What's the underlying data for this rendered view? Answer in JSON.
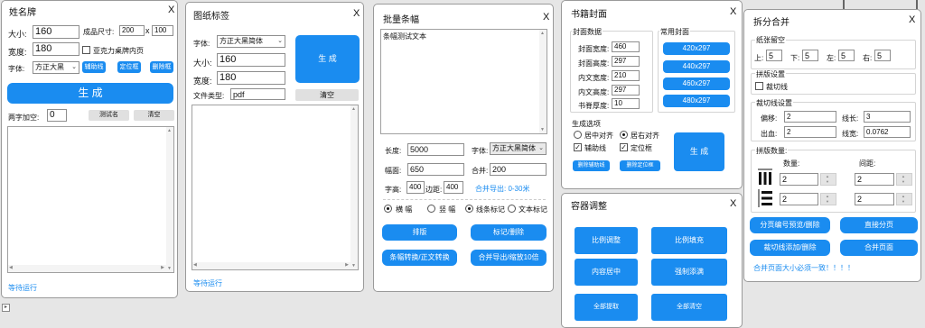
{
  "nameplate": {
    "title": "姓名牌",
    "close": "X",
    "size_label": "大小:",
    "size_value": "160",
    "final_size_label": "成品尺寸:",
    "final_w": "200",
    "final_x": "x",
    "final_h": "100",
    "width_label": "宽度:",
    "width_value": "180",
    "outer_frame_label": "亚克力桌牌内页",
    "font_label": "字体:",
    "font_value": "方正大黑",
    "guide_btn": "辅助线",
    "mark_btn": "定位框",
    "delete_btn": "删除框",
    "generate_btn": "生 成",
    "spacing_label": "两字加空:",
    "spacing_value": "0",
    "test_btn": "测试名",
    "clear_btn": "清空",
    "status": "等待运行"
  },
  "drawing_label": {
    "title": "图纸标签",
    "close": "X",
    "font_label": "字体:",
    "font_value": "方正大黑简体",
    "generate_btn": "生 成",
    "size_label": "大小:",
    "size_value": "160",
    "width_label": "宽度:",
    "width_value": "180",
    "filetype_label": "文件类型:",
    "filetype_value": "pdf",
    "clear_btn": "清空",
    "status": "等待运行"
  },
  "banner": {
    "title": "批量条幅",
    "close": "X",
    "text_value": "条幅测试文本",
    "length_label": "长度:",
    "length_value": "5000",
    "font_label": "字体:",
    "font_value": "方正大黑简体",
    "width_label": "幅面:",
    "width_value": "650",
    "merge_label": "合并:",
    "merge_value": "200",
    "char_height_label": "字高:",
    "char_height_value": "400",
    "margin_label": "边距:",
    "margin_value": "400",
    "merge_note": "合并导出: 0-30米",
    "radio_landscape": "横 幅",
    "radio_portrait": "竖 幅",
    "radio_line_mark": "线条标记",
    "radio_text_mark": "文本标记",
    "layout_btn": "排版",
    "mark_btn": "标记/删除",
    "convert_btn": "条幅转换/正文转换",
    "export_btn": "合并导出/缩放10倍"
  },
  "book_cover": {
    "title": "书籍封面",
    "close": "X",
    "cover_data_label": "封面数据",
    "common_label": "常用封面",
    "cover_w_label": "封面宽度:",
    "cover_w_value": "460",
    "cover_h_label": "封面高度:",
    "cover_h_value": "297",
    "inner_w_label": "内文宽度:",
    "inner_w_value": "210",
    "inner_h_label": "内文高度:",
    "inner_h_value": "297",
    "spine_label": "书脊厚度:",
    "spine_value": "10",
    "presets": [
      "420x297",
      "440x297",
      "460x297",
      "480x297"
    ],
    "options_label": "生成选项",
    "align_center": "居中对齐",
    "align_right": "居右对齐",
    "guides_check": "辅助线",
    "mark_check": "定位框",
    "del_guides_btn": "删除辅助线",
    "del_mark_btn": "删除定位框",
    "generate_btn": "生 成"
  },
  "container": {
    "title": "容器调整",
    "close": "X",
    "buttons": [
      "比例调整",
      "比例填充",
      "内容居中",
      "强制添满",
      "全部提取",
      "全部清空"
    ]
  },
  "split_merge": {
    "title": "拆分合并",
    "close": "X",
    "margin_label": "纸张留空",
    "top_label": "上:",
    "top_value": "5",
    "bottom_label": "下:",
    "bottom_value": "5",
    "left_label": "左:",
    "left_value": "5",
    "right_label": "右:",
    "right_value": "5",
    "imposition_label": "拼版设置",
    "cut_line_label": "裁切线",
    "cut_settings_label": "裁切线设置",
    "offset_label": "偏移:",
    "offset_value": "2",
    "line_len_label": "线长:",
    "line_len_value": "3",
    "bleed_label": "出血:",
    "bleed_value": "2",
    "line_w_label": "线宽:",
    "line_w_value": "0.0762",
    "count_label": "拼版数量:",
    "qty_label": "数量:",
    "gap_label": "间距:",
    "cols_value": "2",
    "col_gap_value": "2",
    "rows_value": "2",
    "row_gap_value": "2",
    "btn_preview": "分页编号预览/删除",
    "btn_split": "直接分页",
    "btn_cut": "裁切线添加/删除",
    "btn_merge": "合并页面",
    "note": "合并页面大小必须一致！！！！"
  }
}
